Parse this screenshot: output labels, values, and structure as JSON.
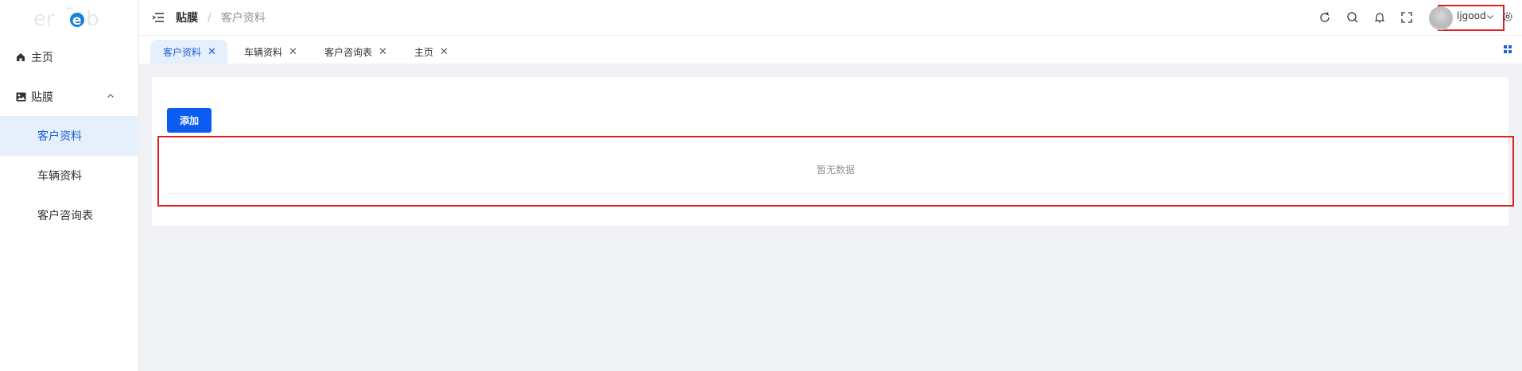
{
  "sidebar": {
    "logo_text": "erheb",
    "items": [
      {
        "label": "主页",
        "icon": "home-icon"
      },
      {
        "label": "贴膜",
        "icon": "image-icon"
      }
    ],
    "subitems": [
      {
        "label": "客户资料",
        "active": true
      },
      {
        "label": "车辆资料",
        "active": false
      },
      {
        "label": "客户咨询表",
        "active": false
      }
    ]
  },
  "header": {
    "breadcrumb": [
      "贴膜",
      "/",
      "客户资料"
    ],
    "username": "ljgood",
    "icons": [
      "refresh-icon",
      "search-icon",
      "bell-icon",
      "fullscreen-icon",
      "settings-icon"
    ]
  },
  "tabs": [
    {
      "label": "客户资料",
      "active": true
    },
    {
      "label": "车辆资料",
      "active": false
    },
    {
      "label": "客户咨询表",
      "active": false
    },
    {
      "label": "主页",
      "active": false
    }
  ],
  "tab_close_glyph": "✕",
  "content": {
    "add_button": "添加",
    "empty_text": "暂无数据"
  },
  "colors": {
    "primary": "#0d5cf2",
    "active_bg": "#e6effc",
    "active_text": "#1e5fd6",
    "highlight_border": "#e02020"
  }
}
